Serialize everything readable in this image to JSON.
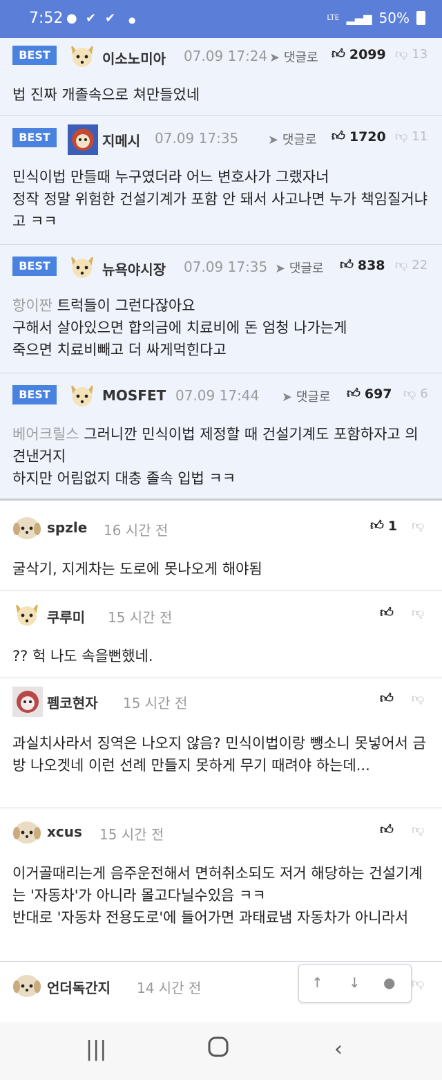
{
  "status": {
    "time": "7:52",
    "network": "LTE",
    "battery": "50%"
  },
  "ui": {
    "best_badge": "BEST",
    "reply_label": "댓글로"
  },
  "best_comments": [
    {
      "nick": "이소노미아",
      "date": "07.09 17:24",
      "up": "2099",
      "down": "13",
      "mention": "",
      "text": "법 진짜 개졸속으로 쳐만들었네"
    },
    {
      "nick": "지메시",
      "date": "07.09 17:35",
      "up": "1720",
      "down": "11",
      "mention": "",
      "text": "민식이법 만들때 누구였더라 어느 변호사가 그랬자너\n정작 정말 위험한 건설기계가 포함 안 돼서 사고나면 누가 책임질거냐고 ㅋㅋ"
    },
    {
      "nick": "뉴욕야시장",
      "date": "07.09 17:35",
      "up": "838",
      "down": "22",
      "mention": "항이짠",
      "text": "트럭들이 그런다잖아요\n구해서 살아있으면 합의금에 치료비에 돈 엄청 나가는게\n죽으면 치료비빼고 더 싸게먹힌다고"
    },
    {
      "nick": "MOSFET",
      "date": "07.09 17:44",
      "up": "697",
      "down": "6",
      "mention": "베어크릴스",
      "text": "그러니깐 민식이법 제정할 때 건설기계도 포함하자고 의견낸거지\n하지만 어림없지 대충 졸속 입법 ㅋㅋ"
    }
  ],
  "comments": [
    {
      "nick": "spzle",
      "time": "16 시간 전",
      "up": "1",
      "text": "굴삭기, 지게차는 도로에 못나오게 해야됨"
    },
    {
      "nick": "쿠루미",
      "time": "15 시간 전",
      "up": "",
      "text": "?? 헉 나도 속을뻔했네."
    },
    {
      "nick": "펨코현자",
      "time": "15 시간 전",
      "up": "",
      "text": "과실치사라서 징역은 나오지 않음? 민식이법이랑 뺑소니 못넣어서 금방 나오겟네 이런 선례 만들지 못하게 무기 때려야 하는데..."
    },
    {
      "nick": "xcus",
      "time": "15 시간 전",
      "up": "",
      "text": "이거골때리는게 음주운전해서 면허취소되도 저거 해당하는 건설기계는 '자동차'가 아니라 몰고다닐수있음 ㅋㅋ\n반대로 '자동차 전용도로'에 들어가면 과태료냄 자동차가 아니라서"
    },
    {
      "nick": "언더독간지",
      "time": "14 시간 전",
      "up": "",
      "text": ""
    }
  ]
}
